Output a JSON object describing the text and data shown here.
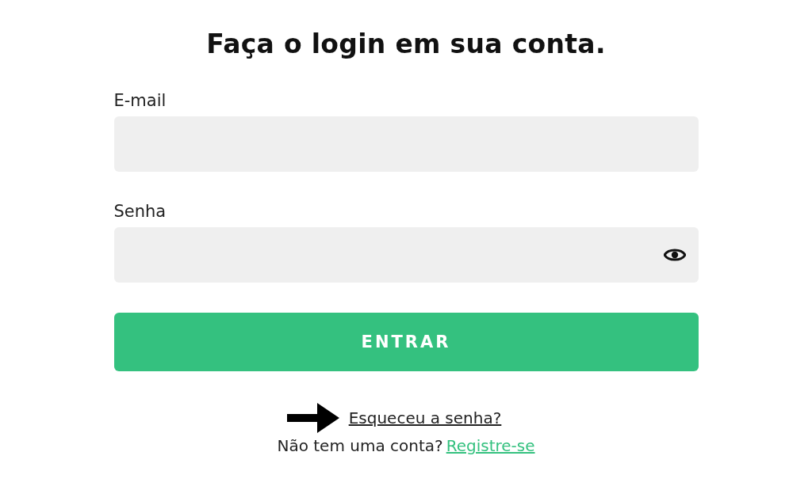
{
  "title": "Faça o login em sua conta.",
  "fields": [
    {
      "label": "E-mail",
      "password_toggle": false
    },
    {
      "label": "Senha",
      "password_toggle": true
    }
  ],
  "submit_button": "ENTRAR",
  "forgot_link": "Esqueceu a senha?",
  "register": {
    "prompt": "Não tem uma conta?",
    "link": "Registre-se"
  }
}
